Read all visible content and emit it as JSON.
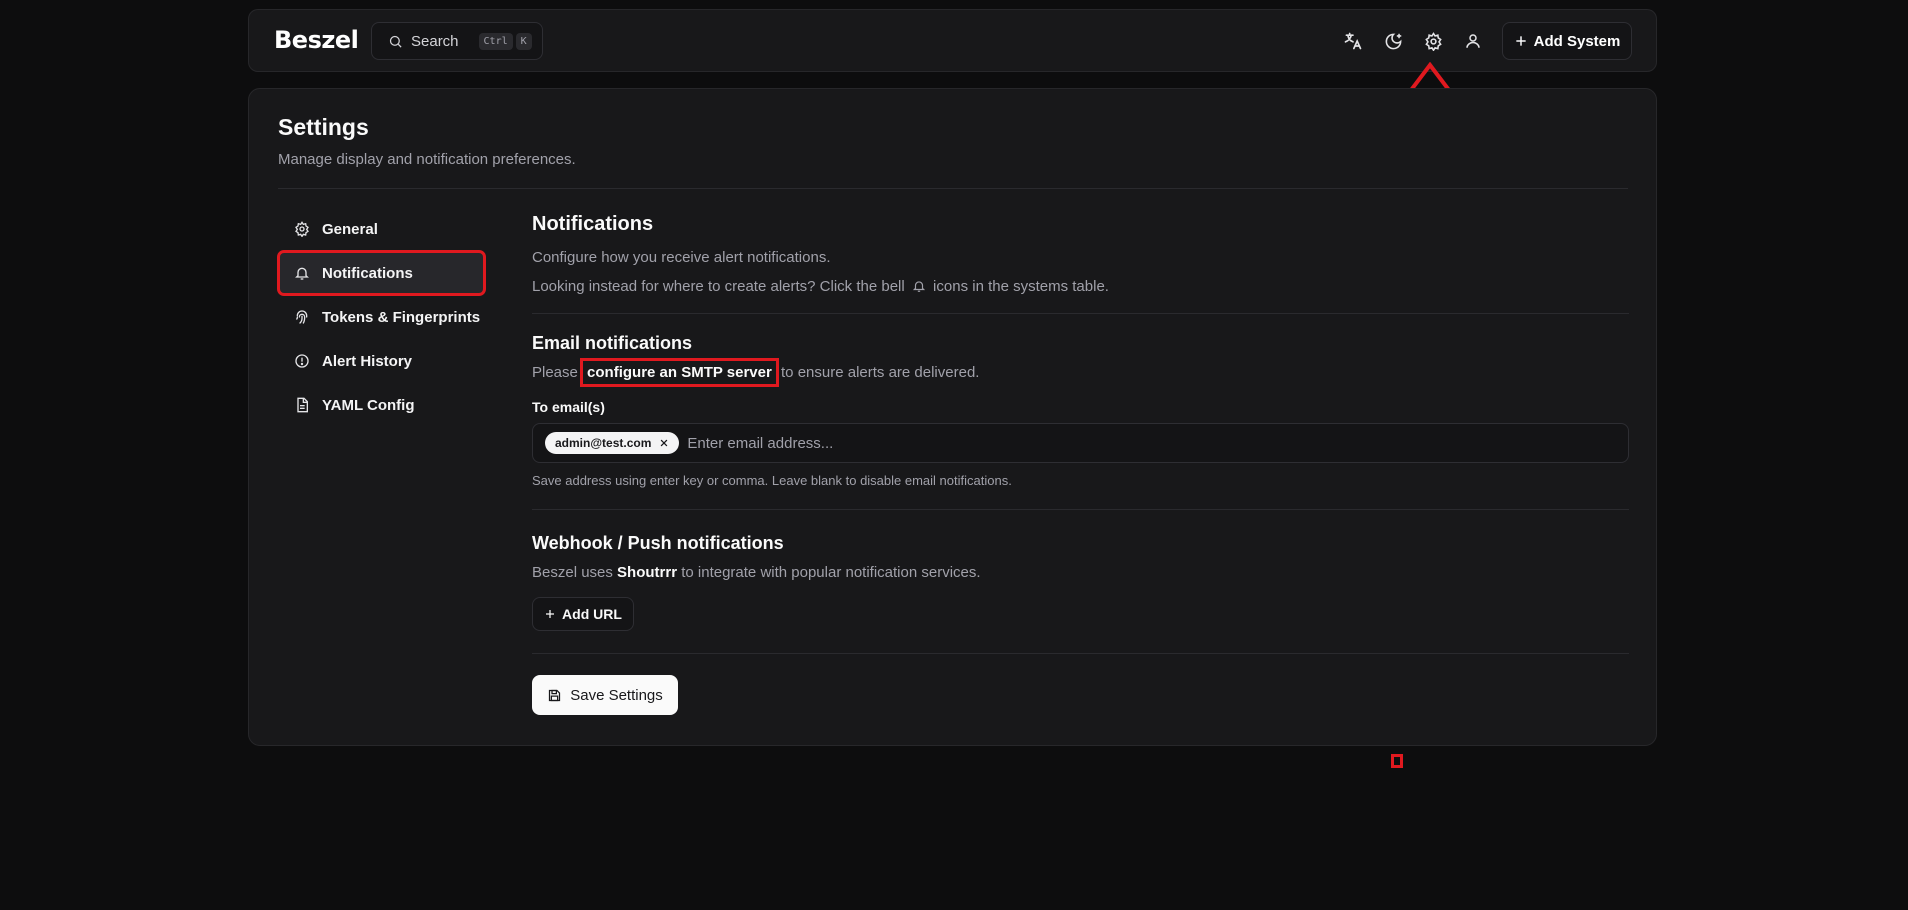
{
  "header": {
    "logo": "Beszel",
    "search": {
      "label": "Search",
      "kbd1": "Ctrl",
      "kbd2": "K"
    },
    "icons": [
      "translate-icon",
      "moon-icon",
      "gear-icon",
      "user-icon"
    ],
    "add_system_label": "Add System"
  },
  "settings": {
    "title": "Settings",
    "subtitle": "Manage display and notification preferences."
  },
  "sidebar": {
    "items": [
      {
        "label": "General",
        "icon": "gear-icon"
      },
      {
        "label": "Notifications",
        "icon": "bell-icon",
        "active": true
      },
      {
        "label": "Tokens & Fingerprints",
        "icon": "fingerprint-icon"
      },
      {
        "label": "Alert History",
        "icon": "alert-circle-icon"
      },
      {
        "label": "YAML Config",
        "icon": "file-icon"
      }
    ]
  },
  "notifications": {
    "title": "Notifications",
    "desc1": "Configure how you receive alert notifications.",
    "desc2_before": "Looking instead for where to create alerts? Click the bell",
    "desc2_after": "icons in the systems table.",
    "email": {
      "title": "Email notifications",
      "desc_before": "Please",
      "desc_link": "configure an SMTP server",
      "desc_after": "to ensure alerts are delivered.",
      "to_label": "To email(s)",
      "chip": "admin@test.com",
      "placeholder": "Enter email address...",
      "help": "Save address using enter key or comma. Leave blank to disable email notifications."
    },
    "webhook": {
      "title": "Webhook / Push notifications",
      "desc_before": "Beszel uses",
      "desc_bold": "Shoutrrr",
      "desc_after": "to integrate with popular notification services.",
      "add_url_label": "Add URL"
    },
    "save_label": "Save Settings"
  },
  "colors": {
    "annotation": "#e0191f",
    "background": "#0d0d0e",
    "card": "#18181a"
  }
}
